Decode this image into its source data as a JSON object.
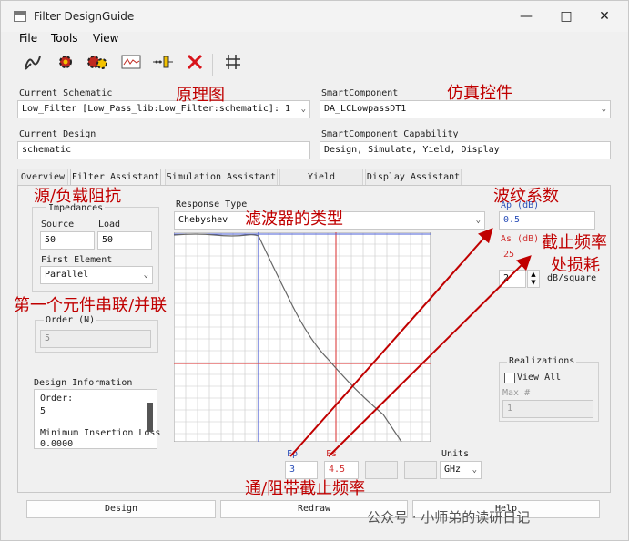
{
  "window": {
    "title": "Filter DesignGuide"
  },
  "menu": {
    "file": "File",
    "tools": "Tools",
    "view": "View"
  },
  "schematic": {
    "label": "Current Schematic",
    "value": "Low_Filter [Low_Pass_lib:Low_Filter:schematic]: 1"
  },
  "smart_component": {
    "label": "SmartComponent",
    "value": "DA_LCLowpassDT1"
  },
  "design": {
    "label": "Current Design",
    "value": "schematic"
  },
  "capability": {
    "label": "SmartComponent Capability",
    "value": "Design, Simulate, Yield, Display"
  },
  "tabs": [
    "Overview",
    "Filter Assistant",
    "Simulation Assistant",
    "Yield Assistant",
    "Display Assistant"
  ],
  "impedances": {
    "title": "Impedances",
    "source_label": "Source",
    "load_label": "Load",
    "source_value": "50",
    "load_value": "50"
  },
  "first_element": {
    "label": "First Element",
    "value": "Parallel"
  },
  "order": {
    "label": "Order (N)",
    "value": "5"
  },
  "design_info": {
    "label": "Design Information",
    "lines": [
      "Order:",
      "5",
      "",
      "Minimum Insertion Loss",
      "0.0000"
    ]
  },
  "response": {
    "label": "Response Type",
    "value": "Chebyshev"
  },
  "ap": {
    "label": "Ap (dB)",
    "value": "0.5"
  },
  "as": {
    "label": "As (dB)",
    "value": "25"
  },
  "slope": {
    "value": "2",
    "unit": "dB/square"
  },
  "fp": {
    "label": "Fp",
    "value": "3"
  },
  "fs": {
    "label": "Fs",
    "value": "4.5"
  },
  "units": {
    "label": "Units",
    "value": "GHz"
  },
  "realizations": {
    "title": "Realizations",
    "view_all": "View All",
    "max_label": "Max #",
    "max_value": "1"
  },
  "buttons": {
    "design": "Design",
    "redraw": "Redraw",
    "help": "Help"
  },
  "annotations": {
    "schematic": "原理图",
    "sim": "仿真控件",
    "impedance": "源/负载阻抗",
    "filter_type": "滤波器的类型",
    "ripple": "波纹系数",
    "cutoff_loss_1": "截止频率",
    "cutoff_loss_2": "处损耗",
    "series_parallel": "第一个元件串联/并联",
    "band_cutoff": "通/阻带截止频率"
  },
  "watermark": "公众号 · 小师弟的读研日记",
  "colors": {
    "annotation": "#c00000",
    "fp_line": "#4a5cd6",
    "fs_line": "#e05050",
    "curve": "#666666"
  }
}
